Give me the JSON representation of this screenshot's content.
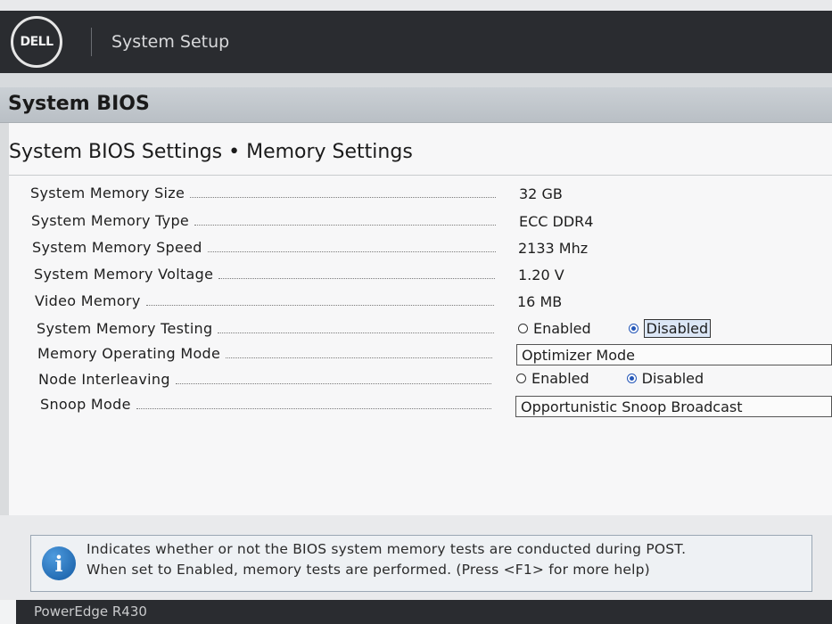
{
  "header": {
    "logo_text": "DELL",
    "title": "System Setup"
  },
  "section": {
    "title": "System BIOS"
  },
  "page": {
    "title": "System BIOS Settings • Memory Settings",
    "rows": [
      {
        "label": "System Memory Size",
        "value": "32 GB"
      },
      {
        "label": "System Memory Type",
        "value": "ECC DDR4"
      },
      {
        "label": "System Memory Speed",
        "value": "2133 Mhz"
      },
      {
        "label": "System Memory Voltage",
        "value": "1.20 V"
      },
      {
        "label": "Video Memory",
        "value": "16 MB"
      },
      {
        "label": "System Memory Testing",
        "options": [
          "Enabled",
          "Disabled"
        ],
        "selected": "Disabled"
      },
      {
        "label": "Memory Operating Mode",
        "value": "Optimizer Mode"
      },
      {
        "label": "Node Interleaving",
        "options": [
          "Enabled",
          "Disabled"
        ],
        "selected": "Disabled"
      },
      {
        "label": "Snoop Mode",
        "value": "Opportunistic Snoop Broadcast"
      }
    ]
  },
  "help": {
    "icon": "info-icon",
    "line1": "Indicates whether or not the BIOS system memory tests are conducted during POST.",
    "line2": "When set to Enabled, memory tests are performed. (Press <F1> for more help)"
  },
  "footer": {
    "model": "PowerEdge R430"
  },
  "colors": {
    "header_bg": "#2a2c30",
    "accent_blue": "#2457b8",
    "info_blue": "#135aa3"
  }
}
